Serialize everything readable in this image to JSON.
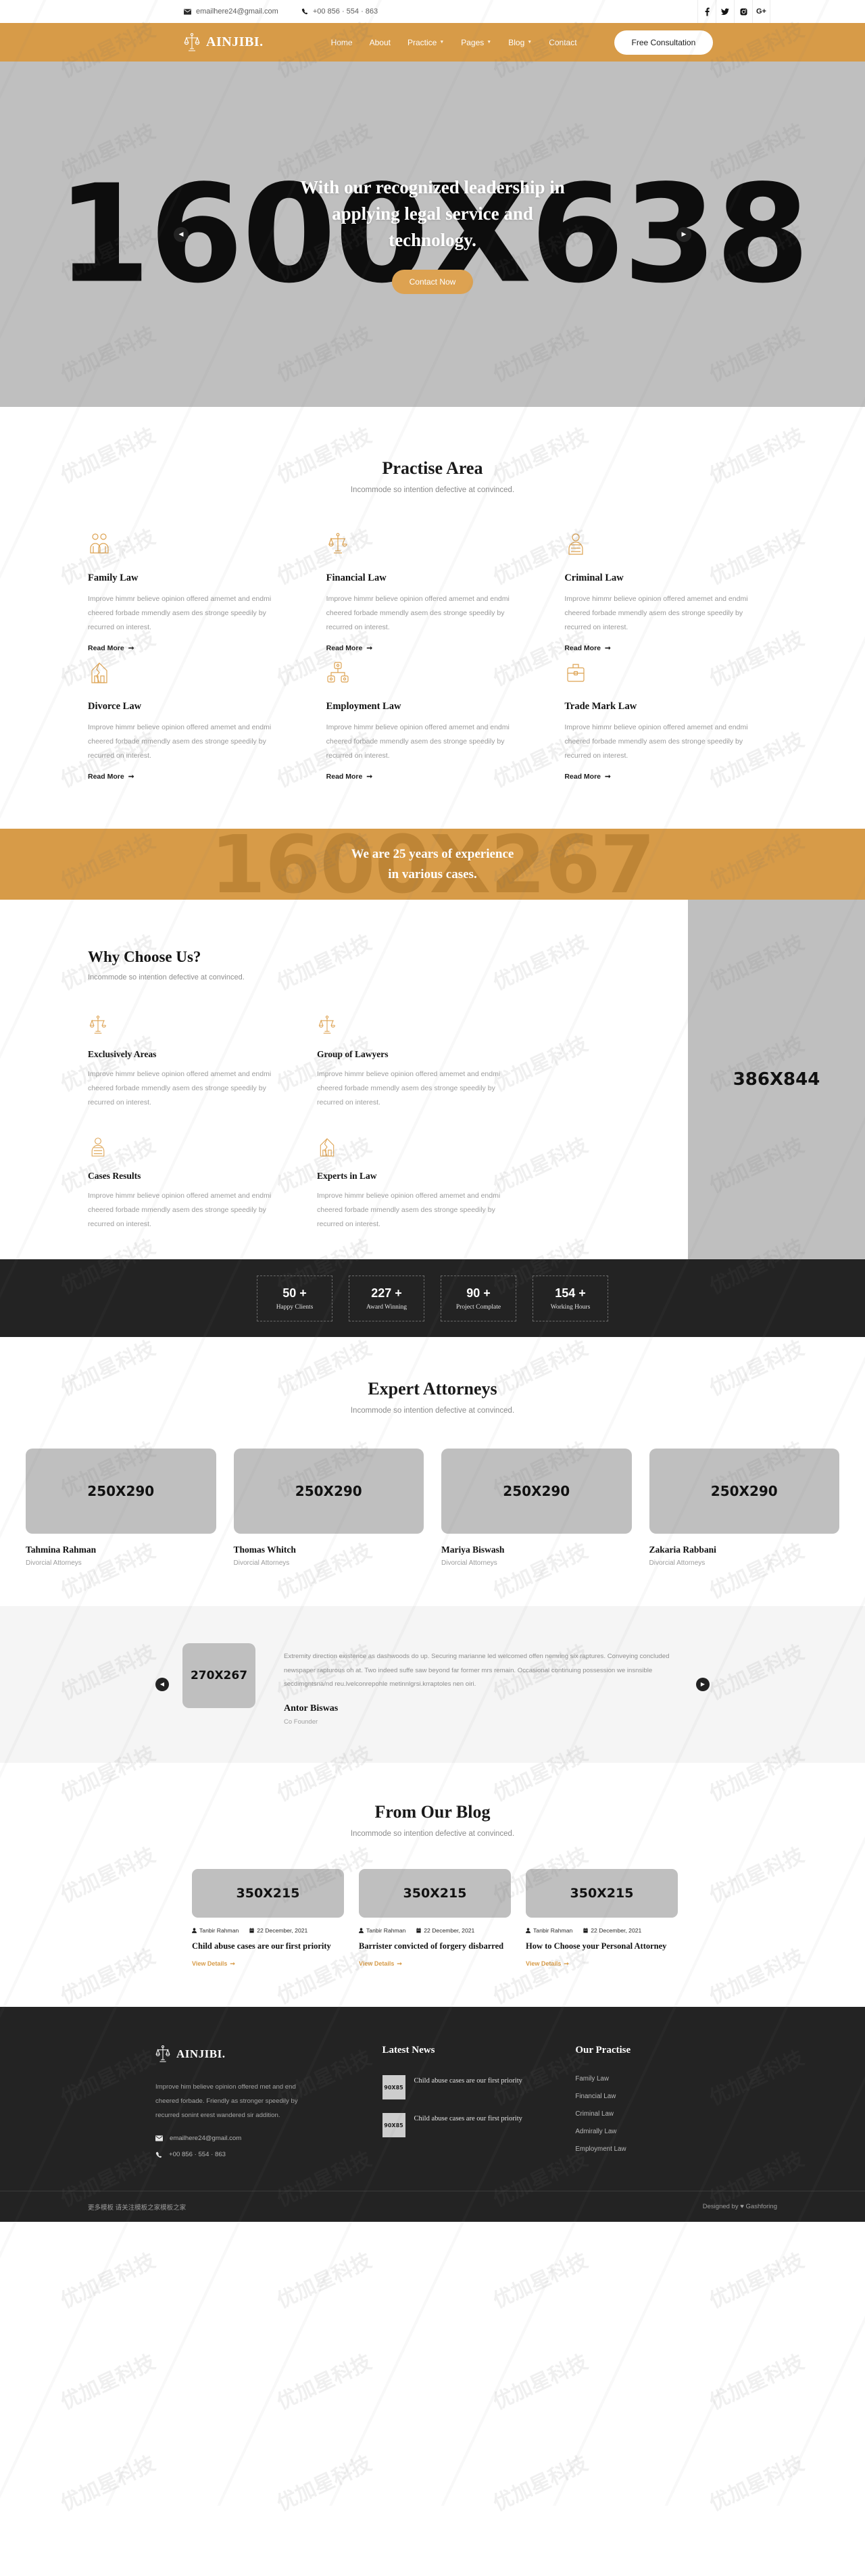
{
  "topbar": {
    "email": "emailhere24@gmail.com",
    "phone": "+00 856 · 554 · 863",
    "email_icon": "envelope-icon",
    "phone_icon": "phone-icon",
    "socials": [
      {
        "name": "facebook-icon",
        "glyph": "f"
      },
      {
        "name": "twitter-icon",
        "glyph": "ᵛ"
      },
      {
        "name": "instagram-icon",
        "glyph": "▣"
      },
      {
        "name": "google-plus-icon",
        "glyph": "G+"
      }
    ]
  },
  "nav": {
    "brand": "AINJIBI.",
    "brand_icon": "scales-of-justice-icon",
    "items": [
      {
        "label": "Home",
        "caret": false
      },
      {
        "label": "About",
        "caret": false
      },
      {
        "label": "Practice",
        "caret": true
      },
      {
        "label": "Pages",
        "caret": true
      },
      {
        "label": "Blog",
        "caret": true
      },
      {
        "label": "Contact",
        "caret": false
      }
    ],
    "cta": "Free Consultation",
    "bg_color": "#d79b48"
  },
  "hero": {
    "placeholder": "1600X638",
    "heading": "With our recognized leadership in applying legal service and technology.",
    "button": "Contact Now",
    "prev_icon": "chevron-left-icon",
    "next_icon": "chevron-right-icon",
    "bg_color": "#bfbfbf"
  },
  "practise": {
    "title": "Practise Area",
    "subtitle": "Incommode so intention defective at convinced.",
    "read_more": "Read More",
    "cards": [
      {
        "icon": "family-icon",
        "title": "Family Law",
        "text": "Improve himmr believe opinion offered amemet and endmi cheered forbade mmendly asem des stronge speedily by recurred on interest."
      },
      {
        "icon": "scales-icon",
        "title": "Financial Law",
        "text": "Improve himmr believe opinion offered amemet and endmi cheered forbade mmendly asem des stronge speedily by recurred on interest."
      },
      {
        "icon": "prisoner-icon",
        "title": "Criminal Law",
        "text": "Improve himmr believe opinion offered amemet and endmi cheered forbade mmendly asem des stronge speedily by recurred on interest."
      },
      {
        "icon": "broken-home-icon",
        "title": "Divorce Law",
        "text": "Improve himmr believe opinion offered amemet and endmi cheered forbade mmendly asem des stronge speedily by recurred on interest."
      },
      {
        "icon": "hierarchy-icon",
        "title": "Employment Law",
        "text": "Improve himmr believe opinion offered amemet and endmi cheered forbade mmendly asem des stronge speedily by recurred on interest."
      },
      {
        "icon": "briefcase-icon",
        "title": "Trade Mark Law",
        "text": "Improve himmr believe opinion offered amemet and endmi cheered forbade mmendly asem des stronge speedily by recurred on interest."
      }
    ]
  },
  "experience_banner": {
    "placeholder": "1600X267",
    "line1": "We are 25 years of experience",
    "line2": "in various cases.",
    "bg_color": "#d79b48"
  },
  "why": {
    "title": "Why Choose Us?",
    "subtitle": "Incommode so intention defective at convinced.",
    "image_placeholder": "386X844",
    "cards": [
      {
        "icon": "scales-icon",
        "title": "Exclusively Areas",
        "text": "Improve himmr believe opinion offered amemet and endmi cheered forbade mmendly asem des stronge speedily by recurred on interest."
      },
      {
        "icon": "scales-icon",
        "title": "Group of Lawyers",
        "text": "Improve himmr believe opinion offered amemet and endmi cheered forbade mmendly asem des stronge speedily by recurred on interest."
      },
      {
        "icon": "prisoner-icon",
        "title": "Cases Results",
        "text": "Improve himmr believe opinion offered amemet and endmi cheered forbade mmendly asem des stronge speedily by recurred on interest."
      },
      {
        "icon": "broken-home-icon",
        "title": "Experts in Law",
        "text": "Improve himmr believe opinion offered amemet and endmi cheered forbade mmendly asem des stronge speedily by recurred on interest."
      }
    ]
  },
  "counters": [
    {
      "value": "50 +",
      "label": "Happy Clients"
    },
    {
      "value": "227 +",
      "label": "Award Winning"
    },
    {
      "value": "90 +",
      "label": "Project Complate"
    },
    {
      "value": "154 +",
      "label": "Working Hours"
    }
  ],
  "attorneys": {
    "title": "Expert Attorneys",
    "subtitle": "Incommode so intention defective at convinced.",
    "members": [
      {
        "placeholder": "250X290",
        "name": "Tahmina Rahman",
        "role": "Divorcial Attorneys"
      },
      {
        "placeholder": "250X290",
        "name": "Thomas Whitch",
        "role": "Divorcial Attorneys"
      },
      {
        "placeholder": "250X290",
        "name": "Mariya Biswash",
        "role": "Divorcial Attorneys"
      },
      {
        "placeholder": "250X290",
        "name": "Zakaria Rabbani",
        "role": "Divorcial Attorneys"
      }
    ]
  },
  "testimonial": {
    "placeholder": "270X267",
    "quote": "Extremity direction existence as dashwoods do up. Securing marianne led welcomed offen nemring six raptures. Conveying concluded newspaper rapturous oh at. Two indeed suffe saw beyond far former mrs remain. Occasional continuing possession we insnsible secdimgntsna/nd reu.lvelconrepohle metinnlgrsi.krraptoles nen oiri.",
    "name": "Antor Biswas",
    "role": "Co Founder",
    "prev_icon": "chevron-left-icon",
    "next_icon": "chevron-right-icon"
  },
  "blog": {
    "title": "From Our Blog",
    "subtitle": "Incommode so intention defective at convinced.",
    "view_details": "View Details",
    "posts": [
      {
        "placeholder": "350X215",
        "author": "Tanbir Rahman",
        "date": "22 December, 2021",
        "title": "Child abuse cases are our first priority"
      },
      {
        "placeholder": "350X215",
        "author": "Tanbir Rahman",
        "date": "22 December, 2021",
        "title": "Barrister convicted of forgery disbarred"
      },
      {
        "placeholder": "350X215",
        "author": "Tanbir Rahman",
        "date": "22 December, 2021",
        "title": "How to Choose your Personal Attorney"
      }
    ]
  },
  "footer": {
    "brand": "AINJIBI.",
    "about": "Improve him believe opinion offered met and end cheered forbade. Friendly as stronger speedily by recurred sonint erest wandered sir addition.",
    "email": "emailhere24@gmail.com",
    "phone": "+00 856 · 554 · 863",
    "news_title": "Latest News",
    "news": [
      {
        "placeholder": "90X85",
        "title": "Child abuse cases are our first priority"
      },
      {
        "placeholder": "90X85",
        "title": "Child abuse cases are our first priority"
      }
    ],
    "practise_title": "Our Practise",
    "practise": [
      "Family Law",
      "Financial Law",
      "Criminal Law",
      "Admirally Law",
      "Employment Law"
    ],
    "copyright": "更多模板 请关注模板之家模板之家",
    "designed_prefix": "Designed by",
    "designed_by": "Gashforing"
  },
  "watermark": "优加星科技"
}
